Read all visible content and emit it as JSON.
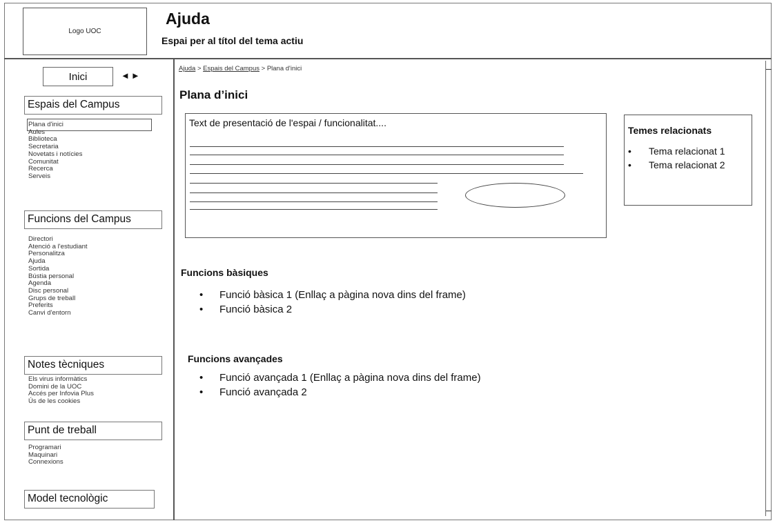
{
  "header": {
    "logo_label": "Logo UOC",
    "title": "Ajuda",
    "subtitle": "Espai per al títol del tema actiu"
  },
  "sidebar": {
    "home_label": "Inici",
    "back_arrow": "◄",
    "forward_arrow": "►",
    "sections": [
      {
        "title": "Espais del Campus",
        "items": [
          "Plana d'inici",
          "Aules",
          "Biblioteca",
          "Secretaria",
          "Novetats i notícies",
          "Comunitat",
          "Recerca",
          "Serveis"
        ]
      },
      {
        "title": "Funcions  del Campus",
        "items": [
          "Directori",
          "Atenció a l'estudiant",
          "Personalitza",
          "Ajuda",
          "Sortida",
          "Bústia personal",
          "Agenda",
          "Disc personal",
          "Grups de treball",
          "Preferits",
          "Canvi d'entorn"
        ]
      },
      {
        "title": "Notes tècniques",
        "items": [
          "Els virus informàtics",
          "Domini de la UOC",
          "Accés per Infovia Plus",
          "Ús de les cookies"
        ]
      },
      {
        "title": "Punt de treball",
        "items": [
          "Programari",
          "Maquinari",
          "Connexions"
        ]
      },
      {
        "title": "Model tecnològic",
        "items": []
      }
    ]
  },
  "main": {
    "breadcrumb": {
      "items": [
        "Ajuda",
        "Espais del Campus",
        "Plana d'inici"
      ],
      "separator": " > "
    },
    "title": "Plana d’inici",
    "intro_text": "Text de presentació de l'espai / funcionalitat....",
    "related": {
      "title": "Temes relacionats",
      "items": [
        "Tema relacionat 1",
        "Tema relacionat 2"
      ]
    },
    "basic_functions": {
      "title": "Funcions bàsiques",
      "items": [
        "Funció bàsica 1  (Enllaç a pàgina nova dins del frame)",
        "Funció bàsica 2"
      ]
    },
    "advanced_functions": {
      "title": "Funcions avançades",
      "items": [
        "Funció avançada 1  (Enllaç a pàgina nova dins del frame)",
        "Funció avançada 2"
      ]
    },
    "bullet": "•"
  }
}
